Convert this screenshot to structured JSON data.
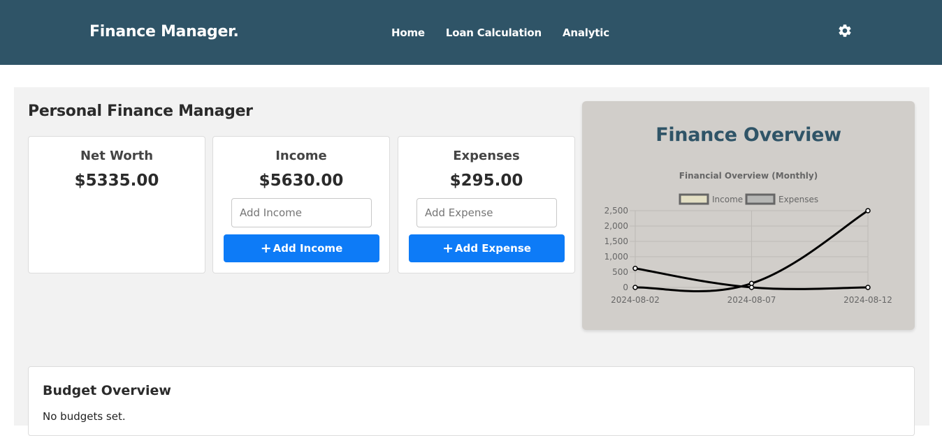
{
  "brand": "Finance Manager.",
  "nav": [
    "Home",
    "Loan Calculation",
    "Analytic"
  ],
  "settings_icon": "gear-icon",
  "page_title": "Personal Finance Manager",
  "cards": {
    "net_worth": {
      "title": "Net Worth",
      "value": "$5335.00"
    },
    "income": {
      "title": "Income",
      "value": "$5630.00",
      "placeholder": "Add Income",
      "button": "Add Income"
    },
    "expenses": {
      "title": "Expenses",
      "value": "$295.00",
      "placeholder": "Add Expense",
      "button": "Add Expense"
    }
  },
  "overview": {
    "heading": "Finance Overview"
  },
  "chart_data": {
    "type": "line",
    "title": "Financial Overview (Monthly)",
    "categories": [
      "2024-08-02",
      "2024-08-07",
      "2024-08-12"
    ],
    "series": [
      {
        "name": "Income",
        "values": [
          0,
          130,
          2500
        ],
        "legend_color": "#e3dfc4"
      },
      {
        "name": "Expenses",
        "values": [
          620,
          0,
          0
        ],
        "legend_color": "#b6b7b5"
      }
    ],
    "y_ticks": [
      "0",
      "500",
      "1,000",
      "1,500",
      "2,000",
      "2,500"
    ],
    "ylim": [
      0,
      2500
    ],
    "line_color": "#000000",
    "grid": true,
    "legend_position": "top"
  },
  "budget": {
    "title": "Budget Overview",
    "empty_text": "No budgets set."
  },
  "colors": {
    "navbar": "#2f5467",
    "button": "#0d7bf7",
    "overview_bg": "#d1ceca",
    "heading": "#2f5467"
  }
}
